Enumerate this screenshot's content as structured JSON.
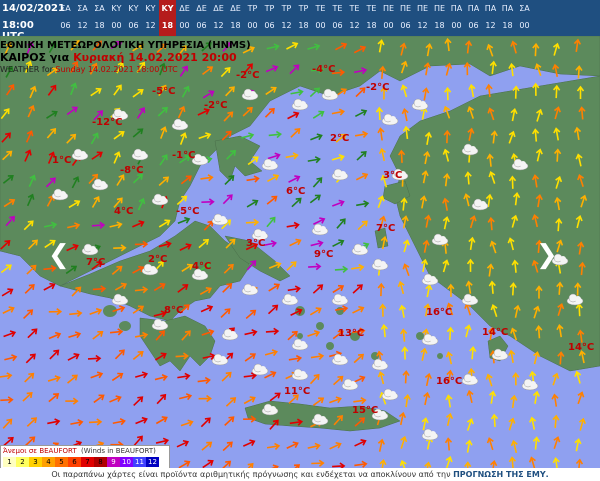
{
  "header": {
    "date": "14/02/2021",
    "time": "18:00 UTC",
    "slots": [
      {
        "day": "ΣΑ",
        "hour": "06"
      },
      {
        "day": "ΣΑ",
        "hour": "12"
      },
      {
        "day": "ΣΑ",
        "hour": "18"
      },
      {
        "day": "ΚΥ",
        "hour": "00"
      },
      {
        "day": "ΚΥ",
        "hour": "06"
      },
      {
        "day": "ΚΥ",
        "hour": "12"
      },
      {
        "day": "ΚΥ",
        "hour": "18",
        "selected": true
      },
      {
        "day": "ΔΕ",
        "hour": "00"
      },
      {
        "day": "ΔΕ",
        "hour": "06"
      },
      {
        "day": "ΔΕ",
        "hour": "12"
      },
      {
        "day": "ΔΕ",
        "hour": "18"
      },
      {
        "day": "ΤΡ",
        "hour": "00"
      },
      {
        "day": "ΤΡ",
        "hour": "06"
      },
      {
        "day": "ΤΡ",
        "hour": "12"
      },
      {
        "day": "ΤΡ",
        "hour": "18"
      },
      {
        "day": "ΤΕ",
        "hour": "00"
      },
      {
        "day": "ΤΕ",
        "hour": "06"
      },
      {
        "day": "ΤΕ",
        "hour": "12"
      },
      {
        "day": "ΤΕ",
        "hour": "18"
      },
      {
        "day": "ΠΕ",
        "hour": "00"
      },
      {
        "day": "ΠΕ",
        "hour": "06"
      },
      {
        "day": "ΠΕ",
        "hour": "12"
      },
      {
        "day": "ΠΕ",
        "hour": "18"
      },
      {
        "day": "ΠΑ",
        "hour": "00"
      },
      {
        "day": "ΠΑ",
        "hour": "06"
      },
      {
        "day": "ΠΑ",
        "hour": "12"
      },
      {
        "day": "ΠΑ",
        "hour": "18"
      },
      {
        "day": "ΣΑ",
        "hour": "00"
      }
    ]
  },
  "title": {
    "agency": "ΕΘΝΙΚΗ ΜΕΤΕΩΡΟΛΟΓΙΚΗ ΥΠΗΡΕΣΙΑ (HNMS)",
    "line2_prefix": "ΚΑΙΡΟΣ για ",
    "line2_date": "Κυριακή 14.02.2021 20:00",
    "line3_prefix": "WEATHER for ",
    "line3_date": "Sunday 14.02.2021 18:00 UTC"
  },
  "temperatures": [
    {
      "label": "-2°C"
    },
    {
      "label": "-4°C"
    },
    {
      "label": "-5°C"
    },
    {
      "label": "-2°C"
    },
    {
      "label": "-2°C"
    },
    {
      "label": "-12°C"
    },
    {
      "label": "-1°C"
    },
    {
      "label": "1°C"
    },
    {
      "label": "-8°C"
    },
    {
      "label": "2°C"
    },
    {
      "label": "6°C"
    },
    {
      "label": "3°C"
    },
    {
      "label": "4°C"
    },
    {
      "label": "-5°C"
    },
    {
      "label": "7°C"
    },
    {
      "label": "3°C"
    },
    {
      "label": "7°C"
    },
    {
      "label": "2°C"
    },
    {
      "label": "4°C"
    },
    {
      "label": "9°C"
    },
    {
      "label": "8°C"
    },
    {
      "label": "16°C"
    },
    {
      "label": "13°C"
    },
    {
      "label": "14°C"
    },
    {
      "label": "14°C"
    },
    {
      "label": "16°C"
    },
    {
      "label": "11°C"
    },
    {
      "label": "15°C"
    }
  ],
  "legend": {
    "left_label": "Άνεμοι σε BEAUFORT",
    "right_label": "(Winds in BEAUFORT)",
    "scale": [
      "1",
      "2",
      "3",
      "4",
      "5",
      "6",
      "7",
      "8",
      "9",
      "10",
      "11",
      "12"
    ],
    "colors": [
      "#ffffc0",
      "#ffff60",
      "#ffd000",
      "#ffa000",
      "#ff7000",
      "#ff4000",
      "#e00000",
      "#b00000",
      "#c000c0",
      "#8000ff",
      "#4040ff",
      "#0000c0"
    ]
  },
  "footer": {
    "text": "Οι παραπάνω χάρτες είναι προϊόντα αριθμητικής πρόγνωσης και ενδέχεται να αποκλίνουν από την ",
    "link": "ΠΡΟΓΝΩΣΗ ΤΗΣ ΕΜΥ."
  },
  "colors": {
    "sea": "#8fa0f0",
    "land": "#5c8a5c",
    "header_bg": "#1f4f80",
    "selected": "#b51c1c",
    "temp_text": "#c00000"
  }
}
